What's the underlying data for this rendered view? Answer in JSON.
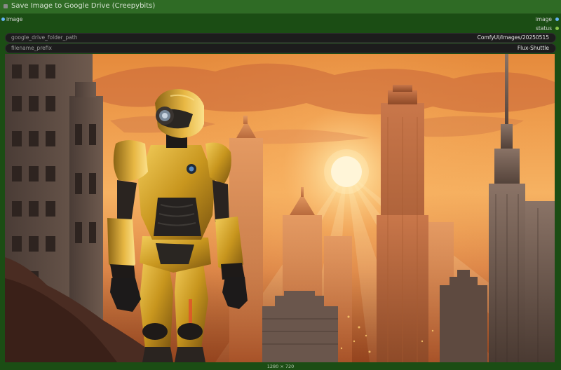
{
  "node": {
    "title": "Save Image to Google Drive (Creepybits)",
    "inputs": [
      {
        "label": "image",
        "color": "#64b5f6"
      }
    ],
    "outputs": [
      {
        "label": "image",
        "color": "#64b5f6"
      },
      {
        "label": "status",
        "color": "#8bc34a"
      }
    ],
    "widgets": [
      {
        "name": "google_drive_folder_path",
        "value": "ComfyUI/Images/20250515"
      },
      {
        "name": "filename_prefix",
        "value": "Flux-Shuttle"
      }
    ],
    "preview": {
      "dimensions": "1280 × 720",
      "subject": "golden humanoid robot overlooking a city skyline at sunset"
    }
  },
  "colors": {
    "node_bg": "#1b4d14",
    "title_bg": "#2f6b25",
    "widget_bg": "#1c1c1c",
    "image_slot": "#64b5f6",
    "status_slot": "#8bc34a"
  }
}
